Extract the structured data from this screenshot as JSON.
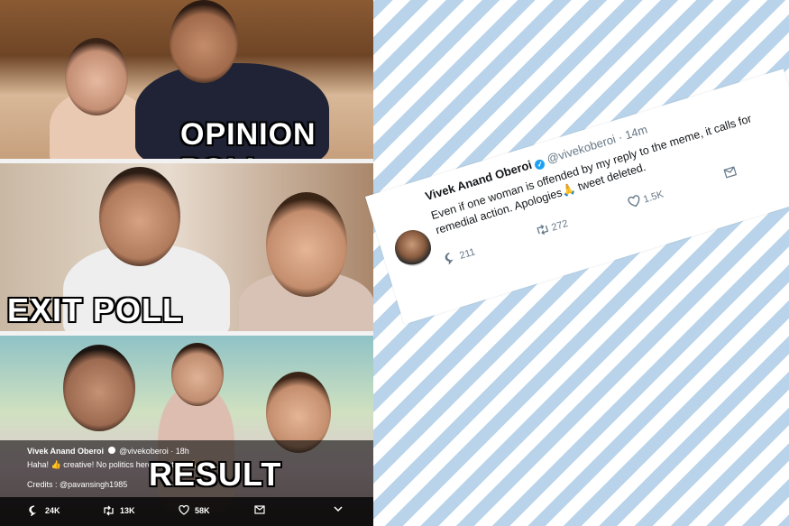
{
  "meme": {
    "captions": {
      "opinion": "OPINION POLL",
      "exit": "EXIT POLL",
      "result": "RESULT"
    },
    "embedded_tweet": {
      "name": "Vivek Anand Oberoi",
      "handle": "@vivekoberoi",
      "time": "· 18h",
      "text": "Haha! 👍 creative! No politics here....just life 🙏😃",
      "credits": "Credits : @pavansingh1985",
      "replies": "24K",
      "retweets": "13K",
      "likes": "58K"
    }
  },
  "tweet_card": {
    "name": "Vivek Anand Oberoi",
    "handle": "@vivekoberoi",
    "time": "· 14m",
    "text": "Even if one woman is offended by my reply to the meme, it calls for remedial action. Apologies🙏 tweet deleted.",
    "replies": "211",
    "retweets": "272",
    "likes": "1.5K"
  },
  "colors": {
    "stripe": "#b9d4ea",
    "verified": "#1da1f2"
  }
}
